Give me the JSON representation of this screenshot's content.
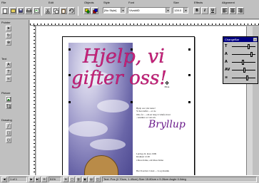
{
  "toolbar": {
    "groups": {
      "file": "File",
      "edit": "Edit",
      "objects": "Objects",
      "style": "Style",
      "font": "Font",
      "size": "Size",
      "effects": "Effects",
      "alignment": "Alignment"
    },
    "style_value": "[No Style]",
    "font_value": "VivaldiD",
    "size_value": "128.0",
    "bold": "B",
    "italic": "I",
    "underline": "U"
  },
  "left_palette": {
    "pointer": "Pointer",
    "text": "Text",
    "picture": "Picture",
    "drawing": "Drawing"
  },
  "document": {
    "headline_line1": "Hjelp, vi",
    "headline_line2": "gifter oss!",
    "move_label": "Move",
    "intro_lines": [
      "Hjelp oss i det neste!",
      "Vi har truffet ... av de",
      "lilla, for ... om en lang vi vilkår, hvad",
      "- Ansikter av ven om."
    ],
    "bryllup": "Bryllup",
    "detail_lines": [
      "Lørdag 24. mars 1999",
      "Klokken 12.00",
      "i Moss Kirke, om Moss Kirke"
    ],
    "footer_line": "Hør hvordan vi skal ... vi og musikk"
  },
  "floating_palette": {
    "title": "ChangeBar",
    "rows": [
      "T",
      "A",
      "A",
      "AV",
      "≡"
    ]
  },
  "status_bar": {
    "page": "1 of 1",
    "zoom": "51%",
    "info": "Text: Pos (2.70cm, 1.49cm)  Size 15.80cm x 9.26cm  Angle 0.0deg"
  }
}
